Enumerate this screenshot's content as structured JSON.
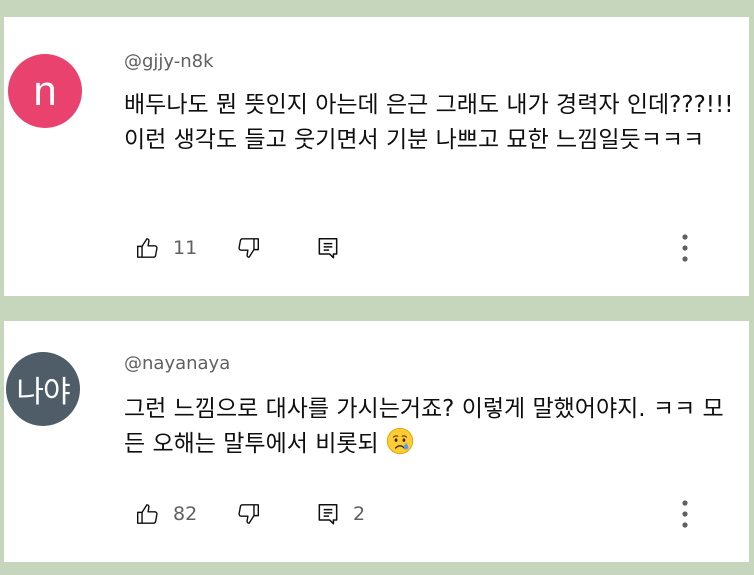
{
  "comments": [
    {
      "avatar_letter": "n",
      "avatar_color": "#e9426f",
      "author": "@gjjy-n8k",
      "text": "배두나도 뭔 뜻인지 아는데 은근 그래도 내가 경력자 인데???!!!이런 생각도 들고 웃기면서 기분 나쁘고 묘한 느낌일듯ㅋㅋㅋ",
      "likes": "11",
      "replies": ""
    },
    {
      "avatar_letter": "나야",
      "avatar_color": "#4f5d69",
      "author": "@nayanaya",
      "text": "그런 느낌으로 대사를 가시는거죠? 이렇게 말했어야지. ㅋㅋ 모든 오해는 말투에서 비롯되",
      "emoji": "crying-face",
      "likes": "82",
      "replies": "2"
    }
  ],
  "icons": {
    "like": "thumbs-up-icon",
    "dislike": "thumbs-down-icon",
    "reply": "comment-icon",
    "more": "more-vertical-icon"
  },
  "colors": {
    "background": "#c5d6bc",
    "card": "#ffffff",
    "secondary_text": "#606060"
  }
}
